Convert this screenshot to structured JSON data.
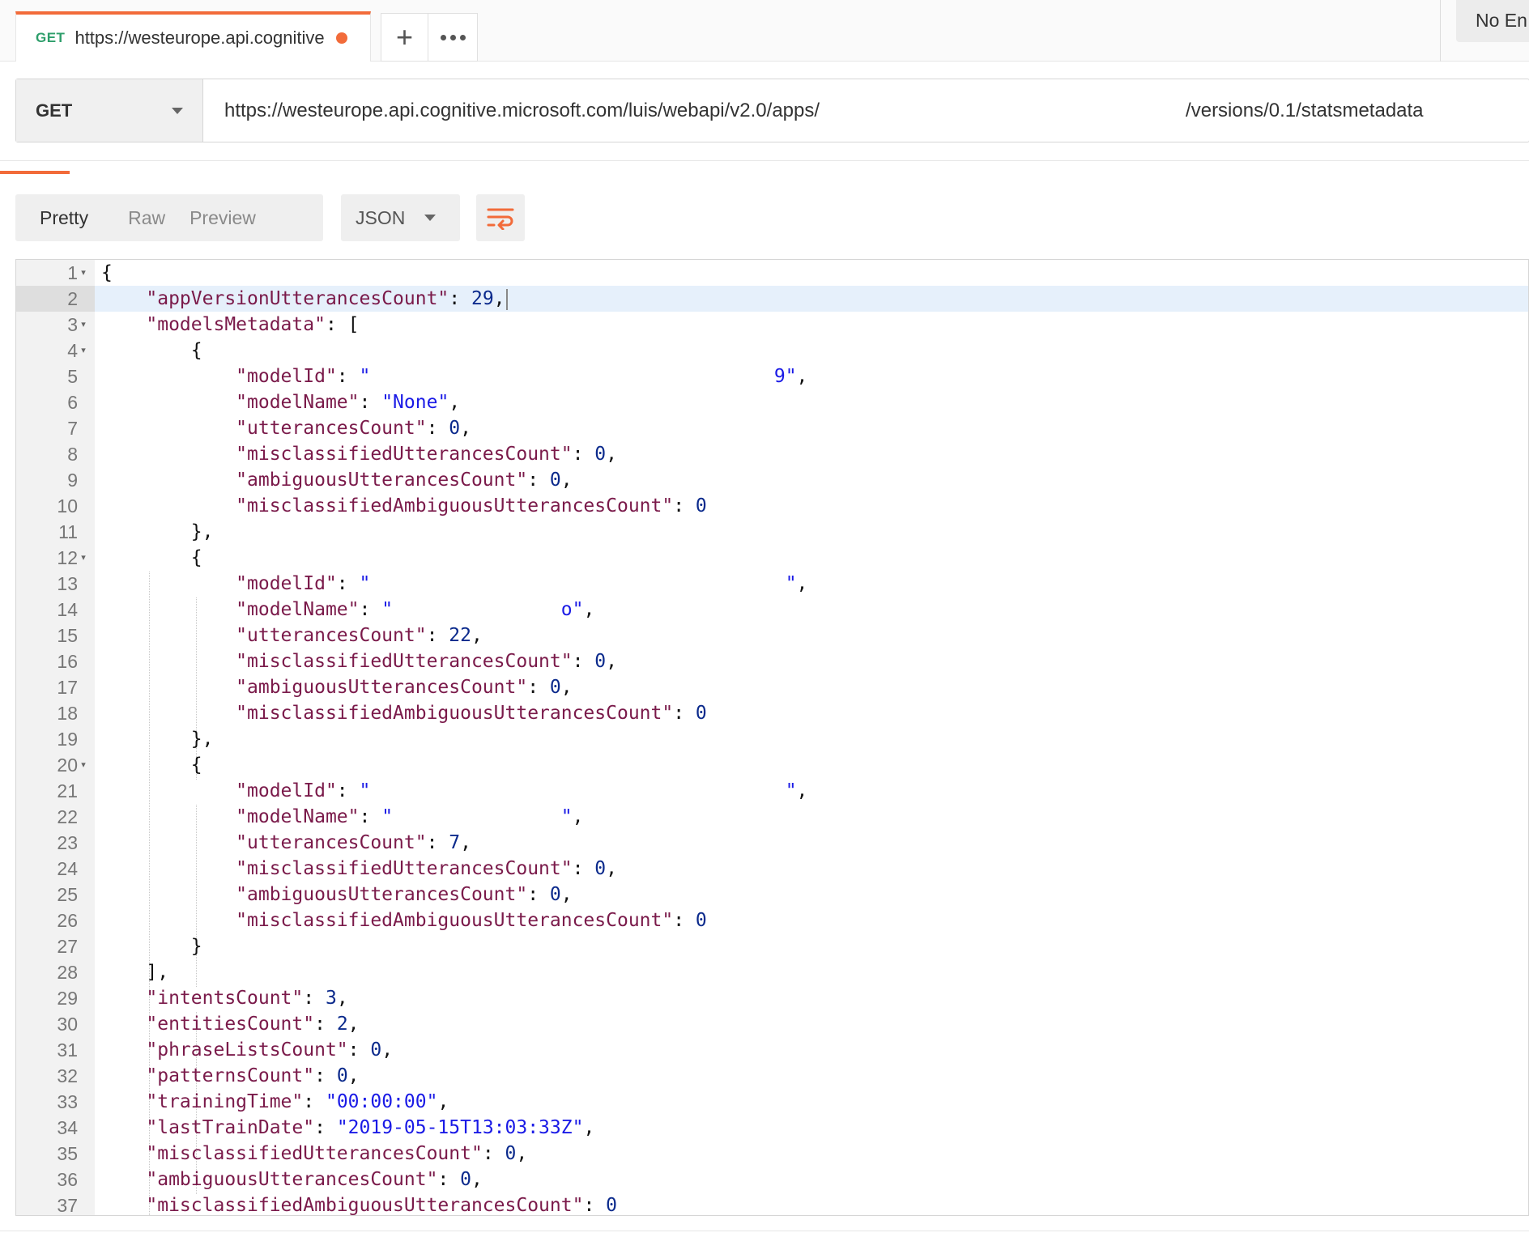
{
  "tab": {
    "method": "GET",
    "url": "https://westeurope.api.cognitive",
    "add_glyph": "+",
    "env_label": "No En"
  },
  "request": {
    "method": "GET",
    "url_prefix": "https://westeurope.api.cognitive.microsoft.com/luis/webapi/v2.0/apps/",
    "url_suffix": "/versions/0.1/statsmetadata"
  },
  "response_toolbar": {
    "views": [
      "Pretty",
      "Raw",
      "Preview"
    ],
    "active_view": "Pretty",
    "format": "JSON",
    "wrap_icon": "wrap-lines-icon"
  },
  "colors": {
    "accent": "#f26b3a",
    "key": "#7a1a4a",
    "string": "#1a1ae6",
    "number": "#0b2a8c"
  },
  "editor": {
    "highlighted_line": 2,
    "lines": [
      {
        "n": 1,
        "fold": true,
        "indent": 0,
        "segs": [
          [
            "p",
            "{"
          ]
        ]
      },
      {
        "n": 2,
        "fold": false,
        "indent": 1,
        "segs": [
          [
            "k",
            "\"appVersionUtterancesCount\""
          ],
          [
            "p",
            ": "
          ],
          [
            "n",
            "29"
          ],
          [
            "p",
            ","
          ]
        ]
      },
      {
        "n": 3,
        "fold": true,
        "indent": 1,
        "segs": [
          [
            "k",
            "\"modelsMetadata\""
          ],
          [
            "p",
            ": ["
          ]
        ]
      },
      {
        "n": 4,
        "fold": true,
        "indent": 2,
        "segs": [
          [
            "p",
            "{"
          ]
        ]
      },
      {
        "n": 5,
        "fold": false,
        "indent": 3,
        "segs": [
          [
            "k",
            "\"modelId\""
          ],
          [
            "p",
            ": "
          ],
          [
            "s",
            "\"                                    9\""
          ],
          [
            "p",
            ","
          ]
        ]
      },
      {
        "n": 6,
        "fold": false,
        "indent": 3,
        "segs": [
          [
            "k",
            "\"modelName\""
          ],
          [
            "p",
            ": "
          ],
          [
            "s",
            "\"None\""
          ],
          [
            "p",
            ","
          ]
        ]
      },
      {
        "n": 7,
        "fold": false,
        "indent": 3,
        "segs": [
          [
            "k",
            "\"utterancesCount\""
          ],
          [
            "p",
            ": "
          ],
          [
            "n",
            "0"
          ],
          [
            "p",
            ","
          ]
        ]
      },
      {
        "n": 8,
        "fold": false,
        "indent": 3,
        "segs": [
          [
            "k",
            "\"misclassifiedUtterancesCount\""
          ],
          [
            "p",
            ": "
          ],
          [
            "n",
            "0"
          ],
          [
            "p",
            ","
          ]
        ]
      },
      {
        "n": 9,
        "fold": false,
        "indent": 3,
        "segs": [
          [
            "k",
            "\"ambiguousUtterancesCount\""
          ],
          [
            "p",
            ": "
          ],
          [
            "n",
            "0"
          ],
          [
            "p",
            ","
          ]
        ]
      },
      {
        "n": 10,
        "fold": false,
        "indent": 3,
        "segs": [
          [
            "k",
            "\"misclassifiedAmbiguousUtterancesCount\""
          ],
          [
            "p",
            ": "
          ],
          [
            "n",
            "0"
          ]
        ]
      },
      {
        "n": 11,
        "fold": false,
        "indent": 2,
        "segs": [
          [
            "p",
            "},"
          ]
        ]
      },
      {
        "n": 12,
        "fold": true,
        "indent": 2,
        "segs": [
          [
            "p",
            "{"
          ]
        ]
      },
      {
        "n": 13,
        "fold": false,
        "indent": 3,
        "segs": [
          [
            "k",
            "\"modelId\""
          ],
          [
            "p",
            ": "
          ],
          [
            "s",
            "\"                                     \""
          ],
          [
            "p",
            ","
          ]
        ]
      },
      {
        "n": 14,
        "fold": false,
        "indent": 3,
        "segs": [
          [
            "k",
            "\"modelName\""
          ],
          [
            "p",
            ": "
          ],
          [
            "s",
            "\"               o\""
          ],
          [
            "p",
            ","
          ]
        ]
      },
      {
        "n": 15,
        "fold": false,
        "indent": 3,
        "segs": [
          [
            "k",
            "\"utterancesCount\""
          ],
          [
            "p",
            ": "
          ],
          [
            "n",
            "22"
          ],
          [
            "p",
            ","
          ]
        ]
      },
      {
        "n": 16,
        "fold": false,
        "indent": 3,
        "segs": [
          [
            "k",
            "\"misclassifiedUtterancesCount\""
          ],
          [
            "p",
            ": "
          ],
          [
            "n",
            "0"
          ],
          [
            "p",
            ","
          ]
        ]
      },
      {
        "n": 17,
        "fold": false,
        "indent": 3,
        "segs": [
          [
            "k",
            "\"ambiguousUtterancesCount\""
          ],
          [
            "p",
            ": "
          ],
          [
            "n",
            "0"
          ],
          [
            "p",
            ","
          ]
        ]
      },
      {
        "n": 18,
        "fold": false,
        "indent": 3,
        "segs": [
          [
            "k",
            "\"misclassifiedAmbiguousUtterancesCount\""
          ],
          [
            "p",
            ": "
          ],
          [
            "n",
            "0"
          ]
        ]
      },
      {
        "n": 19,
        "fold": false,
        "indent": 2,
        "segs": [
          [
            "p",
            "},"
          ]
        ]
      },
      {
        "n": 20,
        "fold": true,
        "indent": 2,
        "segs": [
          [
            "p",
            "{"
          ]
        ]
      },
      {
        "n": 21,
        "fold": false,
        "indent": 3,
        "segs": [
          [
            "k",
            "\"modelId\""
          ],
          [
            "p",
            ": "
          ],
          [
            "s",
            "\"                                     \""
          ],
          [
            "p",
            ","
          ]
        ]
      },
      {
        "n": 22,
        "fold": false,
        "indent": 3,
        "segs": [
          [
            "k",
            "\"modelName\""
          ],
          [
            "p",
            ": "
          ],
          [
            "s",
            "\"               \""
          ],
          [
            "p",
            ","
          ]
        ]
      },
      {
        "n": 23,
        "fold": false,
        "indent": 3,
        "segs": [
          [
            "k",
            "\"utterancesCount\""
          ],
          [
            "p",
            ": "
          ],
          [
            "n",
            "7"
          ],
          [
            "p",
            ","
          ]
        ]
      },
      {
        "n": 24,
        "fold": false,
        "indent": 3,
        "segs": [
          [
            "k",
            "\"misclassifiedUtterancesCount\""
          ],
          [
            "p",
            ": "
          ],
          [
            "n",
            "0"
          ],
          [
            "p",
            ","
          ]
        ]
      },
      {
        "n": 25,
        "fold": false,
        "indent": 3,
        "segs": [
          [
            "k",
            "\"ambiguousUtterancesCount\""
          ],
          [
            "p",
            ": "
          ],
          [
            "n",
            "0"
          ],
          [
            "p",
            ","
          ]
        ]
      },
      {
        "n": 26,
        "fold": false,
        "indent": 3,
        "segs": [
          [
            "k",
            "\"misclassifiedAmbiguousUtterancesCount\""
          ],
          [
            "p",
            ": "
          ],
          [
            "n",
            "0"
          ]
        ]
      },
      {
        "n": 27,
        "fold": false,
        "indent": 2,
        "segs": [
          [
            "p",
            "}"
          ]
        ]
      },
      {
        "n": 28,
        "fold": false,
        "indent": 1,
        "segs": [
          [
            "p",
            "],"
          ]
        ]
      },
      {
        "n": 29,
        "fold": false,
        "indent": 1,
        "segs": [
          [
            "k",
            "\"intentsCount\""
          ],
          [
            "p",
            ": "
          ],
          [
            "n",
            "3"
          ],
          [
            "p",
            ","
          ]
        ]
      },
      {
        "n": 30,
        "fold": false,
        "indent": 1,
        "segs": [
          [
            "k",
            "\"entitiesCount\""
          ],
          [
            "p",
            ": "
          ],
          [
            "n",
            "2"
          ],
          [
            "p",
            ","
          ]
        ]
      },
      {
        "n": 31,
        "fold": false,
        "indent": 1,
        "segs": [
          [
            "k",
            "\"phraseListsCount\""
          ],
          [
            "p",
            ": "
          ],
          [
            "n",
            "0"
          ],
          [
            "p",
            ","
          ]
        ]
      },
      {
        "n": 32,
        "fold": false,
        "indent": 1,
        "segs": [
          [
            "k",
            "\"patternsCount\""
          ],
          [
            "p",
            ": "
          ],
          [
            "n",
            "0"
          ],
          [
            "p",
            ","
          ]
        ]
      },
      {
        "n": 33,
        "fold": false,
        "indent": 1,
        "segs": [
          [
            "k",
            "\"trainingTime\""
          ],
          [
            "p",
            ": "
          ],
          [
            "s",
            "\"00:00:00\""
          ],
          [
            "p",
            ","
          ]
        ]
      },
      {
        "n": 34,
        "fold": false,
        "indent": 1,
        "segs": [
          [
            "k",
            "\"lastTrainDate\""
          ],
          [
            "p",
            ": "
          ],
          [
            "s",
            "\"2019-05-15T13:03:33Z\""
          ],
          [
            "p",
            ","
          ]
        ]
      },
      {
        "n": 35,
        "fold": false,
        "indent": 1,
        "segs": [
          [
            "k",
            "\"misclassifiedUtterancesCount\""
          ],
          [
            "p",
            ": "
          ],
          [
            "n",
            "0"
          ],
          [
            "p",
            ","
          ]
        ]
      },
      {
        "n": 36,
        "fold": false,
        "indent": 1,
        "segs": [
          [
            "k",
            "\"ambiguousUtterancesCount\""
          ],
          [
            "p",
            ": "
          ],
          [
            "n",
            "0"
          ],
          [
            "p",
            ","
          ]
        ]
      },
      {
        "n": 37,
        "fold": false,
        "indent": 1,
        "segs": [
          [
            "k",
            "\"misclassifiedAmbiguousUtterancesCount\""
          ],
          [
            "p",
            ": "
          ],
          [
            "n",
            "0"
          ]
        ]
      }
    ]
  }
}
